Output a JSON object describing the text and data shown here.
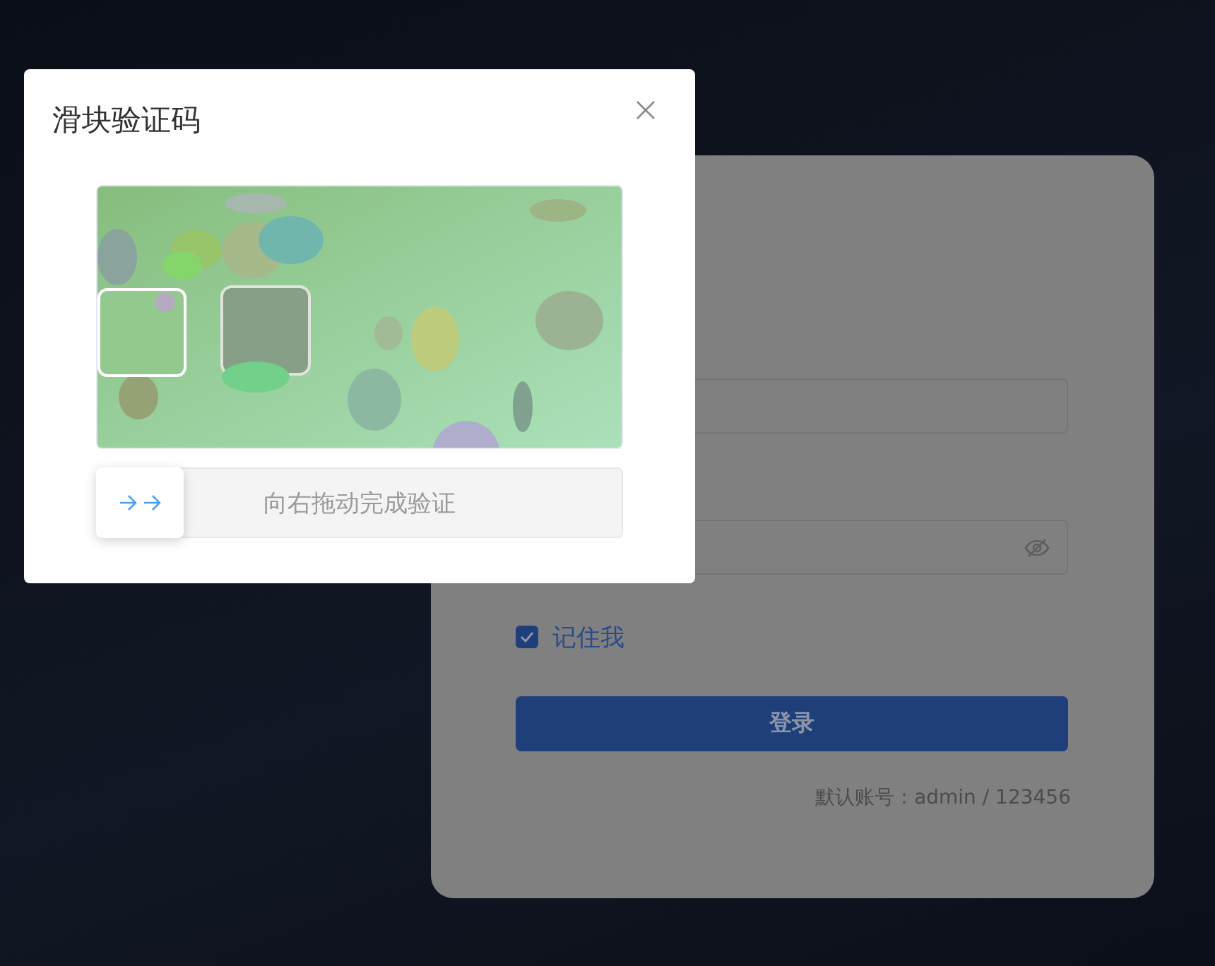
{
  "login_card": {
    "password_field": {
      "masked": true
    },
    "remember": {
      "label": "记住我",
      "checked": true
    },
    "login_button": "登录",
    "default_account_hint": "默认账号：admin / 123456"
  },
  "captcha_dialog": {
    "title": "滑块验证码",
    "slider": {
      "hint": "向右拖动完成验证",
      "level": 0
    }
  }
}
